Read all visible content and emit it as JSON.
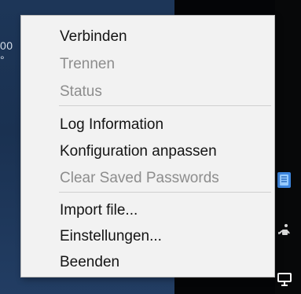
{
  "background": {
    "clipped_text": "00 °",
    "tray_icons": [
      {
        "name": "vpn-icon",
        "color": "#4c93e6"
      },
      {
        "name": "lock-network-icon",
        "color": "#d9d9d9"
      },
      {
        "name": "monitor-icon",
        "color": "#ffffff"
      }
    ]
  },
  "context_menu": {
    "items": [
      {
        "label": "Verbinden",
        "enabled": true
      },
      {
        "label": "Trennen",
        "enabled": false
      },
      {
        "label": "Status",
        "enabled": false
      },
      {
        "label": "Log Information",
        "enabled": true
      },
      {
        "label": "Konfiguration anpassen",
        "enabled": true
      },
      {
        "label": "Clear Saved Passwords",
        "enabled": false
      },
      {
        "label": "Import file...",
        "enabled": true
      },
      {
        "label": "Einstellungen...",
        "enabled": true
      },
      {
        "label": "Beenden",
        "enabled": true
      }
    ]
  },
  "colors": {
    "menu_background": "#f2f2f2",
    "enabled_text": "#141414",
    "disabled_text": "#8d8d8d",
    "separator": "#d0d0d0",
    "desktop_blue": "#1d3658"
  }
}
